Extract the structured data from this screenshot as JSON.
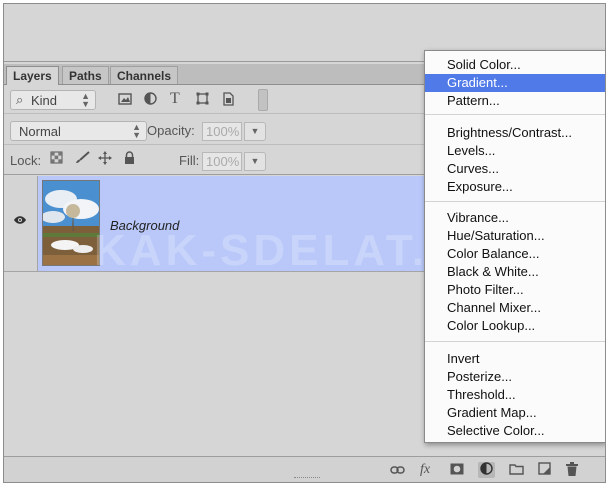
{
  "panel": {
    "tabs": [
      {
        "label": "Layers",
        "active": true
      },
      {
        "label": "Paths",
        "active": false
      },
      {
        "label": "Channels",
        "active": false
      }
    ],
    "filter": {
      "kind_label": "Kind",
      "icons": [
        "image-filter-icon",
        "adjustment-filter-icon",
        "type-filter-icon",
        "shape-filter-icon",
        "smart-object-filter-icon"
      ],
      "type_glyph": "T"
    },
    "blend_mode": "Normal",
    "opacity_label": "Opacity:",
    "opacity_value": "100%",
    "lock_label": "Lock:",
    "fill_label": "Fill:",
    "fill_value": "100%",
    "layers": [
      {
        "name": "Background",
        "visible": true,
        "selected": true
      }
    ],
    "watermark": "KAK-SDELAT.ORG"
  },
  "bottom_bar": {
    "buttons": [
      "link-layers-icon",
      "fx-icon",
      "add-mask-icon",
      "new-adjustment-layer-icon",
      "new-group-icon",
      "new-layer-icon",
      "delete-layer-icon"
    ],
    "fx_text": "fx"
  },
  "adjustment_menu": {
    "groups": [
      [
        "Solid Color...",
        "Gradient...",
        "Pattern..."
      ],
      [
        "Brightness/Contrast...",
        "Levels...",
        "Curves...",
        "Exposure..."
      ],
      [
        "Vibrance...",
        "Hue/Saturation...",
        "Color Balance...",
        "Black & White...",
        "Photo Filter...",
        "Channel Mixer...",
        "Color Lookup..."
      ],
      [
        "Invert",
        "Posterize...",
        "Threshold...",
        "Gradient Map...",
        "Selective Color..."
      ]
    ],
    "highlighted": "Gradient...",
    "highlight_color": "#4f7ae8"
  },
  "colors": {
    "selected_layer_bg": "#b9c8f9",
    "panel_bg": "#d6d6d6"
  }
}
